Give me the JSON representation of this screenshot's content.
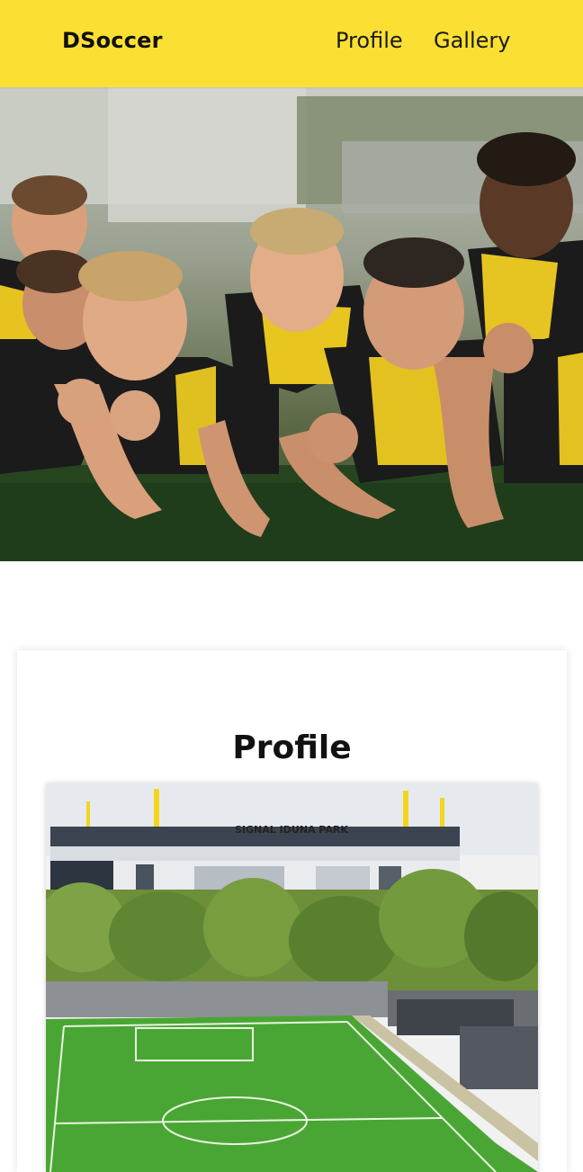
{
  "navbar": {
    "brand": "DSoccer",
    "links": [
      {
        "label": "Profile"
      },
      {
        "label": "Gallery"
      }
    ]
  },
  "hero": {
    "image": "youth-soccer-team-photo"
  },
  "profile_card": {
    "title": "Profile",
    "image": "stadium-photo",
    "stadium_sign": "SIGNAL IDUNA PARK"
  },
  "colors": {
    "accent": "#fbe033",
    "jersey_black": "#1b1b1b",
    "text": "#111111"
  }
}
